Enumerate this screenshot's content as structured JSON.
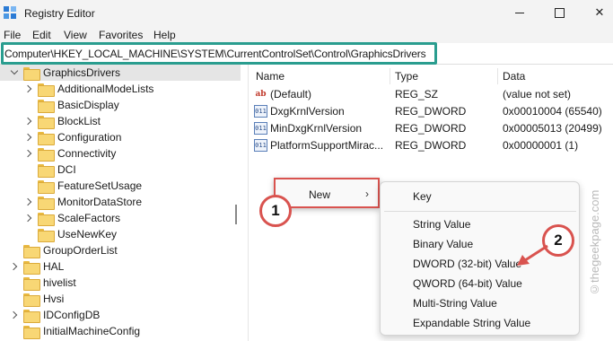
{
  "window": {
    "title": "Registry Editor",
    "controls": {
      "minimize": "minimize-icon",
      "maximize": "maximize-icon",
      "close": "✕"
    }
  },
  "menu": [
    "File",
    "Edit",
    "View",
    "Favorites",
    "Help"
  ],
  "address": "Computer\\HKEY_LOCAL_MACHINE\\SYSTEM\\CurrentControlSet\\Control\\GraphicsDrivers",
  "tree": [
    {
      "label": "GraphicsDrivers",
      "expander": "down",
      "selected": true
    },
    {
      "label": "AdditionalModeLists",
      "expander": "right"
    },
    {
      "label": "BasicDisplay",
      "expander": "none"
    },
    {
      "label": "BlockList",
      "expander": "right"
    },
    {
      "label": "Configuration",
      "expander": "right"
    },
    {
      "label": "Connectivity",
      "expander": "right"
    },
    {
      "label": "DCI",
      "expander": "none"
    },
    {
      "label": "FeatureSetUsage",
      "expander": "none"
    },
    {
      "label": "MonitorDataStore",
      "expander": "right"
    },
    {
      "label": "ScaleFactors",
      "expander": "right"
    },
    {
      "label": "UseNewKey",
      "expander": "none"
    },
    {
      "label": "GroupOrderList",
      "expander": "none"
    },
    {
      "label": "HAL",
      "expander": "right"
    },
    {
      "label": "hivelist",
      "expander": "none"
    },
    {
      "label": "Hvsi",
      "expander": "none"
    },
    {
      "label": "IDConfigDB",
      "expander": "right"
    },
    {
      "label": "InitialMachineConfig",
      "expander": "none"
    }
  ],
  "columns": {
    "name": "Name",
    "type": "Type",
    "data": "Data"
  },
  "values": [
    {
      "icon": "ab",
      "name": "(Default)",
      "type": "REG_SZ",
      "data": "(value not set)"
    },
    {
      "icon": "011",
      "name": "DxgKrnlVersion",
      "type": "REG_DWORD",
      "data": "0x00010004 (65540)"
    },
    {
      "icon": "011",
      "name": "MinDxgKrnlVersion",
      "type": "REG_DWORD",
      "data": "0x00005013 (20499)"
    },
    {
      "icon": "011",
      "name": "PlatformSupportMirac...",
      "type": "REG_DWORD",
      "data": "0x00000001 (1)"
    }
  ],
  "context_menu": {
    "label": "New",
    "arrow": "›"
  },
  "submenu": [
    "Key",
    "String Value",
    "Binary Value",
    "DWORD (32-bit) Value",
    "QWORD (64-bit) Value",
    "Multi-String Value",
    "Expandable String Value"
  ],
  "annotations": {
    "step1": "1",
    "step2": "2"
  },
  "watermark": "©thegeekpage.com",
  "colors": {
    "annotation_red": "#d9534f",
    "address_highlight": "#2a9d8f",
    "folder": "#f8d775"
  }
}
